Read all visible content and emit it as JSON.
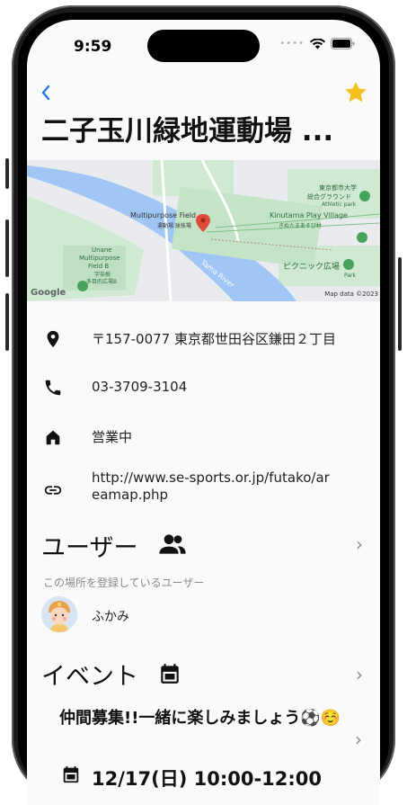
{
  "status_bar": {
    "time": "9:59"
  },
  "place": {
    "title": "二子玉川緑地運動場 ..."
  },
  "map": {
    "labels": {
      "multipurpose_field": "Multipurpose Field",
      "field_jp": "運動場 球技場",
      "university": "東京都市大学",
      "university_ground": "総合グラウンド",
      "athletic_park": "Athletic park",
      "kinutama": "Kinutama Play Village",
      "kinutama_jp": "きぬたまあそび村",
      "unane_1": "Unane",
      "unane_2": "Multipurpose",
      "unane_3": "Field B",
      "unane_4": "宇奈根",
      "unane_5": "多目的広場B",
      "picnic": "ピクニック広場",
      "park": "Park",
      "river": "Tama River",
      "google": "Google",
      "map_data": "Map data ©2023"
    }
  },
  "info": {
    "address": "〒157-0077 東京都世田谷区鎌田２丁目",
    "phone": "03-3709-3104",
    "status": "営業中",
    "url": "http://www.se-sports.or.jp/futako/areamap.php"
  },
  "users_section": {
    "title": "ユーザー",
    "subtitle": "この場所を登録しているユーザー",
    "users": [
      {
        "name": "ふかみ"
      }
    ]
  },
  "events_section": {
    "title": "イベント",
    "events": [
      {
        "title": "仲間募集!!一緒に楽しみましょう⚽☺️",
        "time": "12/17(日) 10:00-12:00"
      }
    ]
  },
  "colors": {
    "accent_blue": "#1e78e6",
    "star": "#f4c01e",
    "map_water": "#9fc6f4",
    "map_green": "#bfe3c2"
  }
}
